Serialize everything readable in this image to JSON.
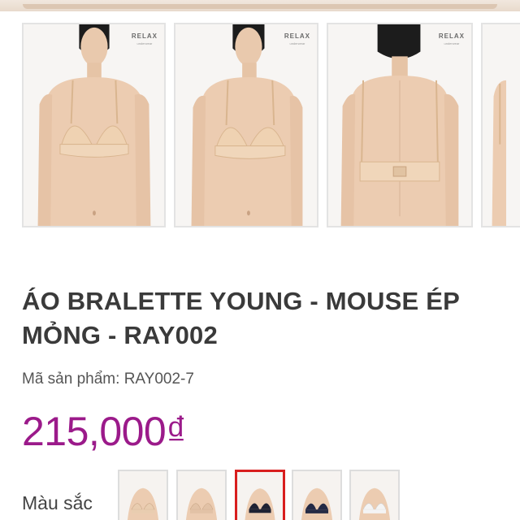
{
  "gallery": {
    "thumbnails": [
      {
        "view": "front",
        "brand": "RELAX",
        "brand_tag": "underwear"
      },
      {
        "view": "front-angle",
        "brand": "RELAX",
        "brand_tag": "underwear"
      },
      {
        "view": "back",
        "brand": "RELAX",
        "brand_tag": "underwear"
      },
      {
        "view": "side-partial"
      }
    ]
  },
  "product": {
    "title": "ÁO BRALETTE YOUNG - MOUSE ÉP MỎNG - RAY002",
    "sku_label": "Mã sản phẩm:",
    "sku_value": "RAY002-7",
    "price": "215,000₫",
    "price_color": "#9b1a8a"
  },
  "colors": {
    "label": "Màu sắc",
    "selected_index": 2,
    "selected_border": "#d81e1e",
    "options": [
      {
        "color": "#e9cdb0"
      },
      {
        "color": "#e2c2a6"
      },
      {
        "color": "#1f2233"
      },
      {
        "color": "#242a45"
      },
      {
        "color": "#f4f4f4"
      }
    ]
  }
}
